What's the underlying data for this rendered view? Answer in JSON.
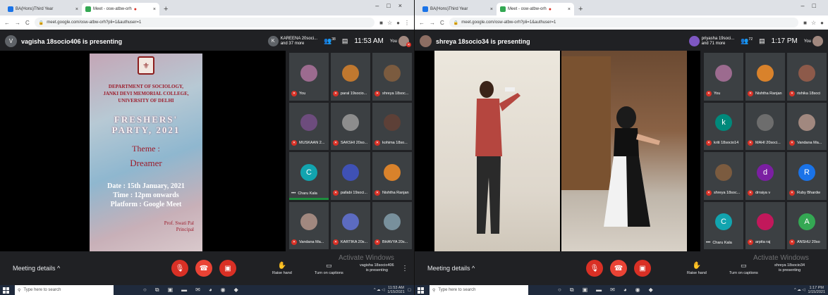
{
  "left": {
    "tabs": [
      {
        "label": "BA(Hons)Third Year",
        "active": false
      },
      {
        "label": "Meet - osw-atbw-orh",
        "active": true,
        "recording": true
      }
    ],
    "url": "meet.google.com/osw-atbw-orh?pli=1&authuser=1",
    "presenter": {
      "initial": "V",
      "text": "vagisha 18socio406 is presenting"
    },
    "people": {
      "initial": "K",
      "line1": "KAREENA 20soci...",
      "line2": "and 37 more"
    },
    "participant_count": "38",
    "time": "11:53 AM",
    "you_label": "You",
    "poster": {
      "dept": "DEPARTMENT OF SOCIOLOGY,",
      "college": "JANKI DEVI MEMORIAL COLLEGE,",
      "univ": "UNIVERSITY OF DELHI",
      "party1": "FRESHERS'",
      "party2": "PARTY, 2021",
      "theme": "Theme :",
      "dreamer": "Dreamer",
      "date": "Date : 15th January, 2021",
      "timeline": "Time : 12pm onwards",
      "platform": "Platform : Google Meet",
      "sig1": "Prof. Swati Pal",
      "sig2": "Principal"
    },
    "tiles": [
      {
        "name": "You",
        "initial": "",
        "color": "#9c6b8f",
        "muted": true
      },
      {
        "name": "paral 19socio...",
        "initial": "",
        "color": "#c0782f",
        "muted": true
      },
      {
        "name": "shreya 18soc...",
        "initial": "",
        "color": "#7b5b3f",
        "muted": true
      },
      {
        "name": "MUSKAAN 2...",
        "initial": "",
        "color": "#6d4c7d",
        "muted": true
      },
      {
        "name": "SAKSHI 20so...",
        "initial": "",
        "color": "#8d8d8d",
        "muted": true
      },
      {
        "name": "kohima 18so...",
        "initial": "",
        "color": "#5d4037",
        "muted": true
      },
      {
        "name": "Charu Kala",
        "initial": "C",
        "color": "#12a4af",
        "muted": false,
        "speaking": true
      },
      {
        "name": "pallabi 19soci...",
        "initial": "",
        "color": "#3f51b5",
        "muted": true
      },
      {
        "name": "Nishtha Ranjan",
        "initial": "",
        "color": "#d9822b",
        "muted": true
      },
      {
        "name": "Vandana Ma...",
        "initial": "",
        "color": "#a1887f",
        "muted": true
      },
      {
        "name": "KARTIKA 20s...",
        "initial": "",
        "color": "#5c6bc0",
        "muted": true
      },
      {
        "name": "BHAVYA 20s...",
        "initial": "",
        "color": "#78909c",
        "muted": true
      }
    ],
    "bottom": {
      "meeting_details": "Meeting details",
      "raise_hand": "Raise hand",
      "captions": "Turn on captions",
      "presenting1": "vagisha 18socio406",
      "presenting2": "is presenting",
      "activate": "Activate Windows"
    },
    "taskbar": {
      "search": "Type here to search",
      "time": "11:53 AM",
      "date": "1/15/2021"
    }
  },
  "right": {
    "tabs": [
      {
        "label": "BA(Hons)Third Year",
        "active": false
      },
      {
        "label": "Meet - osw-atbw-orh",
        "active": true,
        "recording": true
      }
    ],
    "url": "meet.google.com/osw-atbw-orh?pli=1&authuser=1",
    "presenter": {
      "initial": "",
      "text": "shreya 18socio34 is presenting"
    },
    "people": {
      "initial": "",
      "line1": "priyasha 19soci...",
      "line2": "and 71 more"
    },
    "participant_count": "72",
    "time": "1:17 PM",
    "you_label": "You",
    "tiles": [
      {
        "name": "You",
        "initial": "",
        "color": "#9c6b8f",
        "muted": true
      },
      {
        "name": "Nishtha Ranjan",
        "initial": "",
        "color": "#d9822b",
        "muted": true
      },
      {
        "name": "rishika 18soci",
        "initial": "",
        "color": "#8d5a4a",
        "muted": true
      },
      {
        "name": "kriti 18socio14",
        "initial": "k",
        "color": "#00897b",
        "muted": true
      },
      {
        "name": "MAHI 20soci...",
        "initial": "",
        "color": "#6d6d6d",
        "muted": true
      },
      {
        "name": "Vandana Ma...",
        "initial": "",
        "color": "#a1887f",
        "muted": true
      },
      {
        "name": "shreya 18soc...",
        "initial": "",
        "color": "#7b5b3f",
        "muted": true
      },
      {
        "name": "drraiya v",
        "initial": "d",
        "color": "#7b1fa2",
        "muted": true
      },
      {
        "name": "Ruby Bhardw",
        "initial": "R",
        "color": "#1a73e8",
        "muted": true
      },
      {
        "name": "Charu Kala",
        "initial": "C",
        "color": "#12a4af",
        "muted": false
      },
      {
        "name": "arpita raj",
        "initial": "",
        "color": "#c2185b",
        "muted": true
      },
      {
        "name": "ANSHU 20so",
        "initial": "A",
        "color": "#34a853",
        "muted": true
      }
    ],
    "bottom": {
      "meeting_details": "Meeting details",
      "raise_hand": "Raise hand",
      "captions": "Turn on captions",
      "presenting1": "shreya 18socio34",
      "presenting2": "is presenting",
      "activate": "Activate Windows"
    },
    "taskbar": {
      "search": "Type here to search",
      "time": "1:17 PM",
      "date": "1/15/2021"
    }
  }
}
